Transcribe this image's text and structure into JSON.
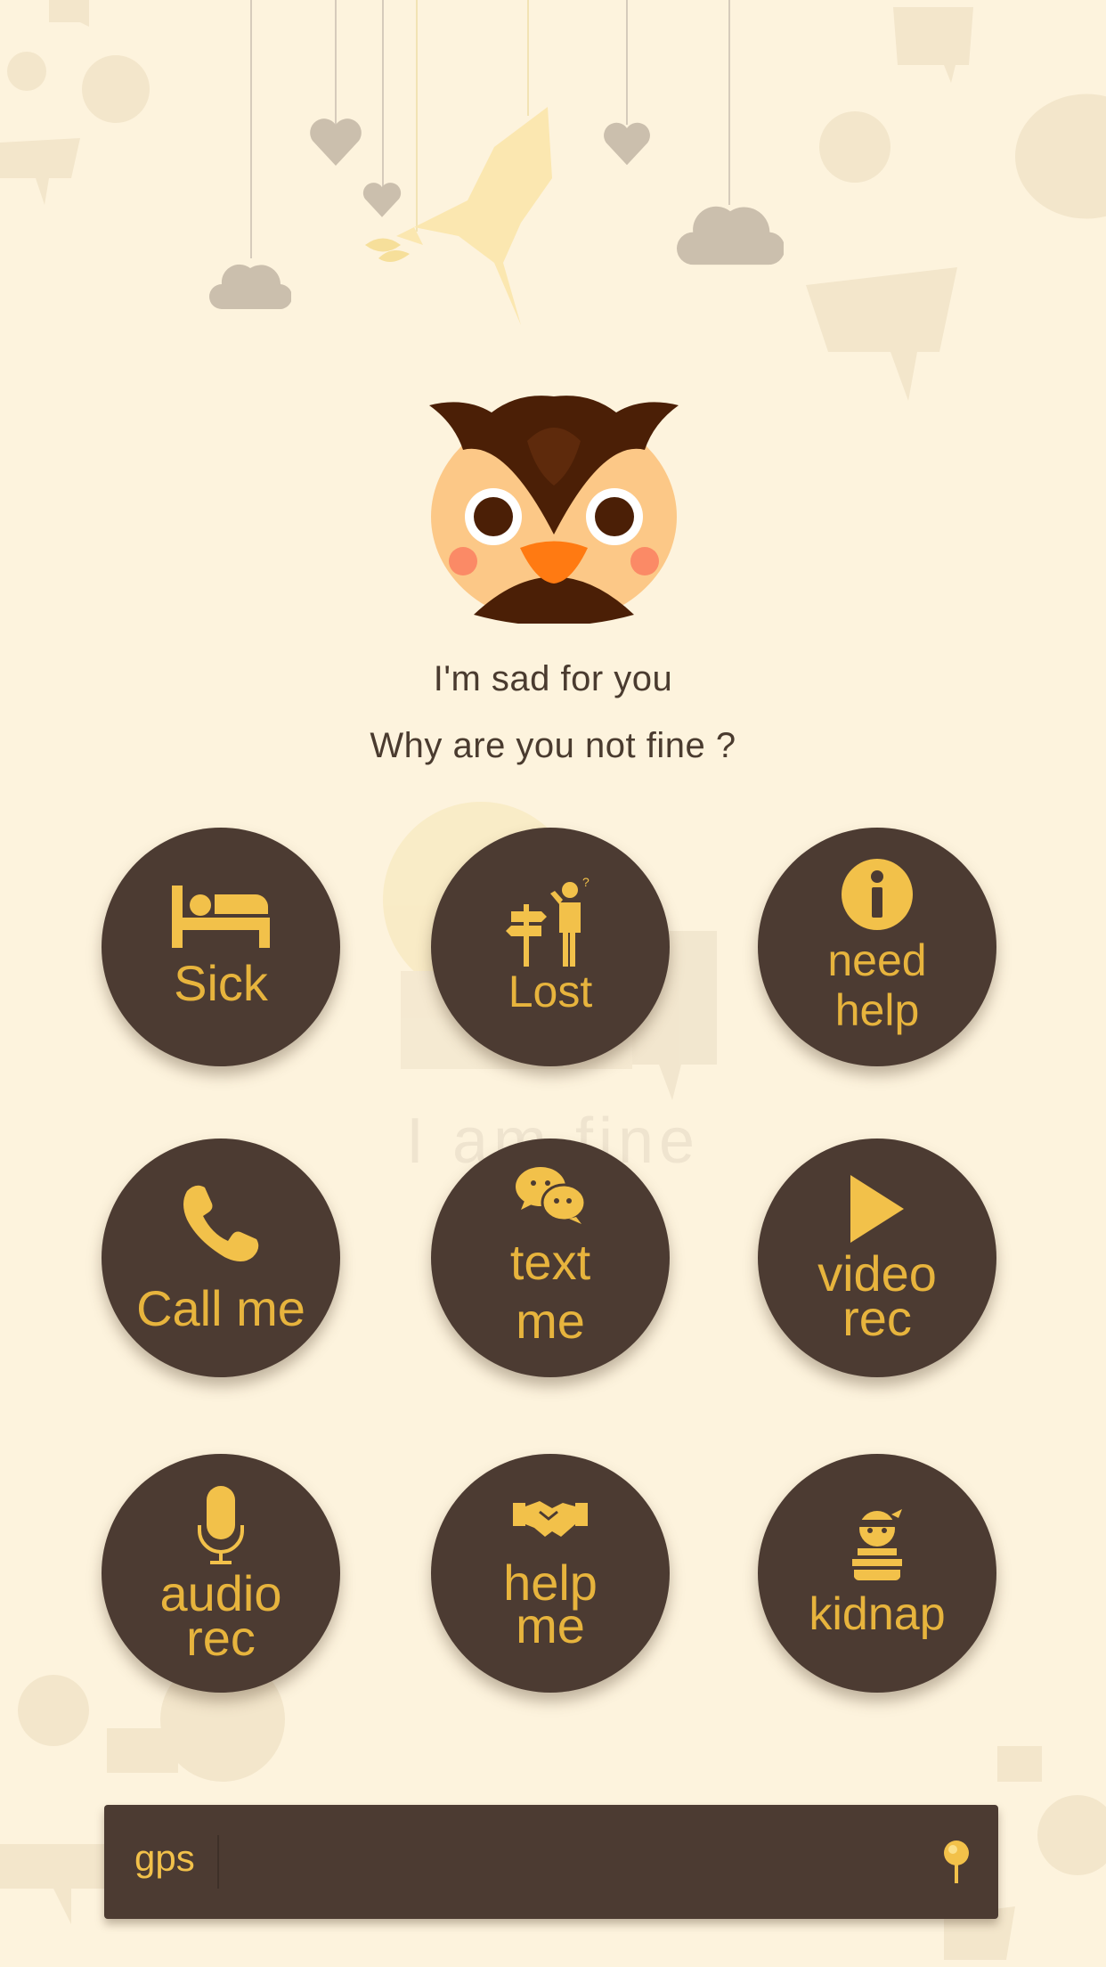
{
  "colors": {
    "background": "#fdf3dd",
    "button_bg": "#4c3b32",
    "button_text": "#e7b43d",
    "icon_yellow": "#f2c14a",
    "message_text": "#4a3b2f"
  },
  "header": {
    "mascot": "owl-icon",
    "decorations": [
      "heart-icon",
      "heart-icon",
      "heart-icon",
      "cloud-icon",
      "cloud-icon",
      "bird-icon"
    ]
  },
  "message": {
    "line1": "I'm sad for you",
    "line2": "Why are you not fine ?"
  },
  "watermark": "I am fine",
  "buttons": [
    {
      "icon": "bed-icon",
      "line1": "Sick",
      "line2": ""
    },
    {
      "icon": "lost-signpost-icon",
      "line1": "Lost",
      "line2": ""
    },
    {
      "icon": "info-icon",
      "line1": "need",
      "line2": "help"
    },
    {
      "icon": "phone-icon",
      "line1": "Call me",
      "line2": ""
    },
    {
      "icon": "chat-bubbles-icon",
      "line1": "text",
      "line2": "me"
    },
    {
      "icon": "play-icon",
      "line1": "video",
      "line2": "rec"
    },
    {
      "icon": "microphone-icon",
      "line1": "audio",
      "line2": "rec"
    },
    {
      "icon": "handshake-icon",
      "line1": "help",
      "line2": "me"
    },
    {
      "icon": "kidnapper-icon",
      "line1": "kidnap",
      "line2": ""
    }
  ],
  "gps": {
    "label": "gps",
    "icon": "pin-icon"
  }
}
